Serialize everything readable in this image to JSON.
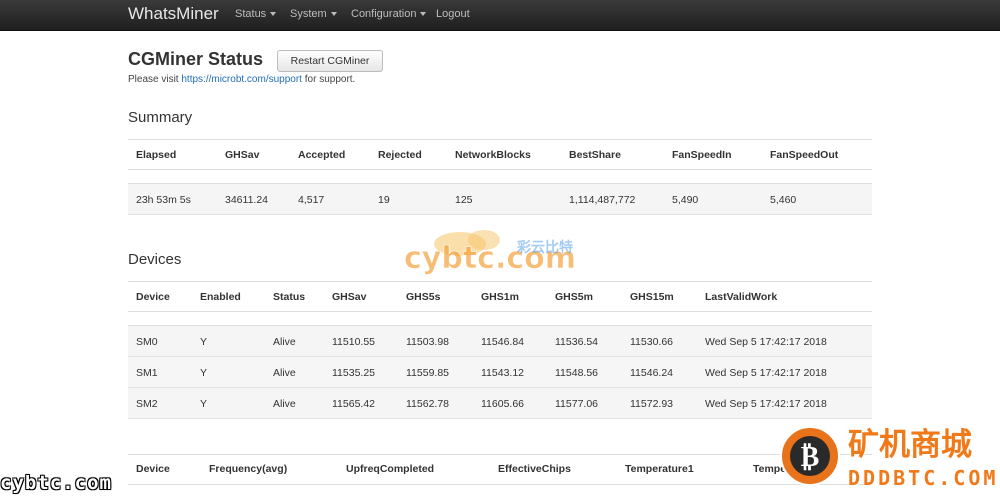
{
  "navbar": {
    "brand": "WhatsMiner",
    "items": [
      {
        "label": "Status",
        "dropdown": true
      },
      {
        "label": "System",
        "dropdown": true
      },
      {
        "label": "Configuration",
        "dropdown": true
      },
      {
        "label": "Logout",
        "dropdown": false
      }
    ]
  },
  "page": {
    "title": "CGMiner Status",
    "restart_label": "Restart CGMiner",
    "support_prefix": "Please visit ",
    "support_link": "https://microbt.com/support",
    "support_suffix": " for support."
  },
  "summary": {
    "title": "Summary",
    "headers": [
      "Elapsed",
      "GHSav",
      "Accepted",
      "Rejected",
      "NetworkBlocks",
      "BestShare",
      "FanSpeedIn",
      "FanSpeedOut"
    ],
    "row": [
      "23h 53m 5s",
      "34611.24",
      "4,517",
      "19",
      "125",
      "1,114,487,772",
      "5,490",
      "5,460"
    ]
  },
  "devices": {
    "title": "Devices",
    "headers": [
      "Device",
      "Enabled",
      "Status",
      "GHSav",
      "GHS5s",
      "GHS1m",
      "GHS5m",
      "GHS15m",
      "LastValidWork"
    ],
    "rows": [
      [
        "SM0",
        "Y",
        "Alive",
        "11510.55",
        "11503.98",
        "11546.84",
        "11536.54",
        "11530.66",
        "Wed Sep 5 17:42:17 2018"
      ],
      [
        "SM1",
        "Y",
        "Alive",
        "11535.25",
        "11559.85",
        "11543.12",
        "11548.56",
        "11546.24",
        "Wed Sep 5 17:42:17 2018"
      ],
      [
        "SM2",
        "Y",
        "Alive",
        "11565.42",
        "11562.78",
        "11605.66",
        "11577.06",
        "11572.93",
        "Wed Sep 5 17:42:17 2018"
      ]
    ]
  },
  "details": {
    "headers": [
      "Device",
      "Frequency(avg)",
      "UpfreqCompleted",
      "EffectiveChips",
      "Temperature1",
      "Tempe"
    ]
  },
  "watermarks": {
    "center": "cybtc.com",
    "center_cn": "彩云比特",
    "bottom_left": "cybtc.com",
    "bottom_right_cn": "矿机商城",
    "bottom_right_en": "DDDBTC.COM"
  },
  "colors": {
    "navbar": "#2b2b2b",
    "link": "#1f6fb5",
    "row_bg": "#f5f5f5",
    "watermark_orange": "#f07a1a"
  }
}
